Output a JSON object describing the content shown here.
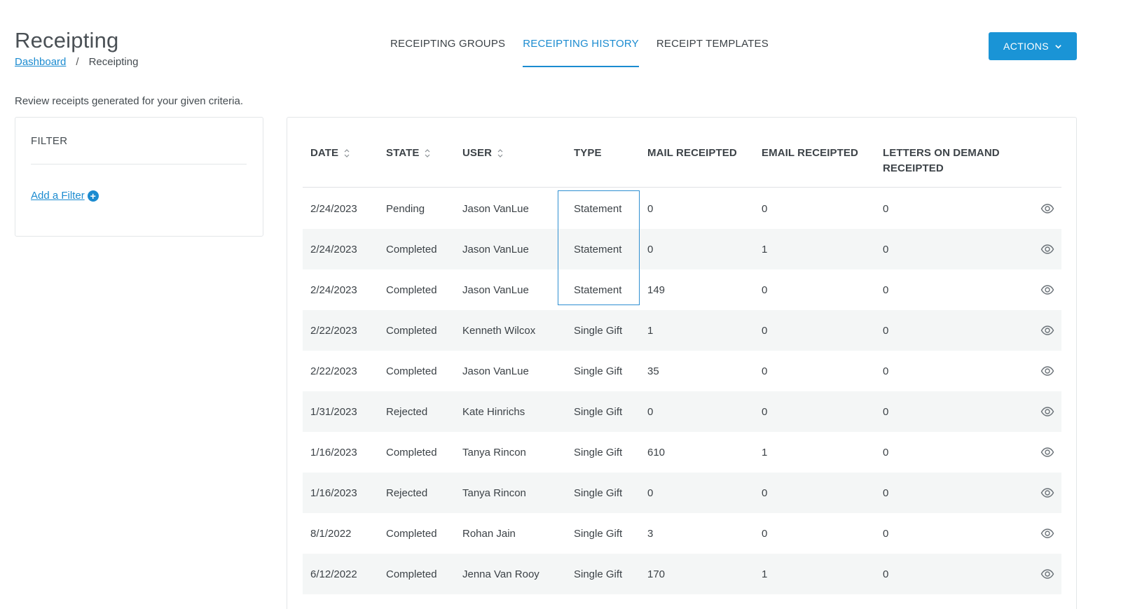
{
  "page": {
    "title": "Receipting",
    "description": "Review receipts generated for your given criteria."
  },
  "breadcrumb": {
    "link": "Dashboard",
    "separator": "/",
    "current": "Receipting"
  },
  "tabs": [
    {
      "label": "RECEIPTING GROUPS",
      "active": false
    },
    {
      "label": "RECEIPTING HISTORY",
      "active": true
    },
    {
      "label": "RECEIPT TEMPLATES",
      "active": false
    }
  ],
  "actions": {
    "label": "ACTIONS",
    "icon": "chevron-down-icon"
  },
  "filter": {
    "title": "FILTER",
    "add_label": "Add a Filter",
    "add_icon": "plus-circle-icon"
  },
  "table": {
    "columns": [
      {
        "label": "DATE",
        "sortable": true
      },
      {
        "label": "STATE",
        "sortable": true
      },
      {
        "label": "USER",
        "sortable": true
      },
      {
        "label": "TYPE",
        "sortable": false
      },
      {
        "label": "MAIL RECEIPTED",
        "sortable": false
      },
      {
        "label": "EMAIL RECEIPTED",
        "sortable": false
      },
      {
        "label": "LETTERS ON DEMAND RECEIPTED",
        "sortable": false
      }
    ],
    "row_action_icon": "eye-icon",
    "rows": [
      {
        "date": "2/24/2023",
        "state": "Pending",
        "user": "Jason VanLue",
        "type": "Statement",
        "mail": "0",
        "email": "0",
        "letters": "0"
      },
      {
        "date": "2/24/2023",
        "state": "Completed",
        "user": "Jason VanLue",
        "type": "Statement",
        "mail": "0",
        "email": "1",
        "letters": "0"
      },
      {
        "date": "2/24/2023",
        "state": "Completed",
        "user": "Jason VanLue",
        "type": "Statement",
        "mail": "149",
        "email": "0",
        "letters": "0"
      },
      {
        "date": "2/22/2023",
        "state": "Completed",
        "user": "Kenneth Wilcox",
        "type": "Single Gift",
        "mail": "1",
        "email": "0",
        "letters": "0"
      },
      {
        "date": "2/22/2023",
        "state": "Completed",
        "user": "Jason VanLue",
        "type": "Single Gift",
        "mail": "35",
        "email": "0",
        "letters": "0"
      },
      {
        "date": "1/31/2023",
        "state": "Rejected",
        "user": "Kate Hinrichs",
        "type": "Single Gift",
        "mail": "0",
        "email": "0",
        "letters": "0"
      },
      {
        "date": "1/16/2023",
        "state": "Completed",
        "user": "Tanya Rincon",
        "type": "Single Gift",
        "mail": "610",
        "email": "1",
        "letters": "0"
      },
      {
        "date": "1/16/2023",
        "state": "Rejected",
        "user": "Tanya Rincon",
        "type": "Single Gift",
        "mail": "0",
        "email": "0",
        "letters": "0"
      },
      {
        "date": "8/1/2022",
        "state": "Completed",
        "user": "Rohan Jain",
        "type": "Single Gift",
        "mail": "3",
        "email": "0",
        "letters": "0"
      },
      {
        "date": "6/12/2022",
        "state": "Completed",
        "user": "Jenna Van Rooy",
        "type": "Single Gift",
        "mail": "170",
        "email": "1",
        "letters": "0"
      }
    ]
  },
  "colors": {
    "accent": "#1b8bd0",
    "button": "#1a94d6",
    "row_alt": "#f4f6f6"
  }
}
